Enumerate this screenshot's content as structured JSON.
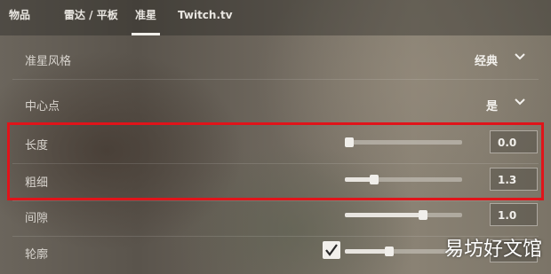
{
  "tabs": [
    {
      "label": "物品"
    },
    {
      "label": "雷达 / 平板"
    },
    {
      "label": "准星"
    },
    {
      "label": "Twitch.tv"
    }
  ],
  "settings": {
    "crosshair_style": {
      "label": "准星风格",
      "value": "经典"
    },
    "center_dot": {
      "label": "中心点",
      "value": "是"
    },
    "length": {
      "label": "长度",
      "value": "0.0",
      "fraction": 0.0
    },
    "thickness": {
      "label": "粗细",
      "value": "1.3",
      "fraction": 0.25
    },
    "gap": {
      "label": "间隙",
      "value": "1.0",
      "fraction": 0.67
    },
    "outline": {
      "label": "轮廓",
      "checked": true,
      "fraction": 0.38
    }
  },
  "watermark": "易坊好文馆",
  "colors": {
    "highlight": "#e0141a"
  }
}
